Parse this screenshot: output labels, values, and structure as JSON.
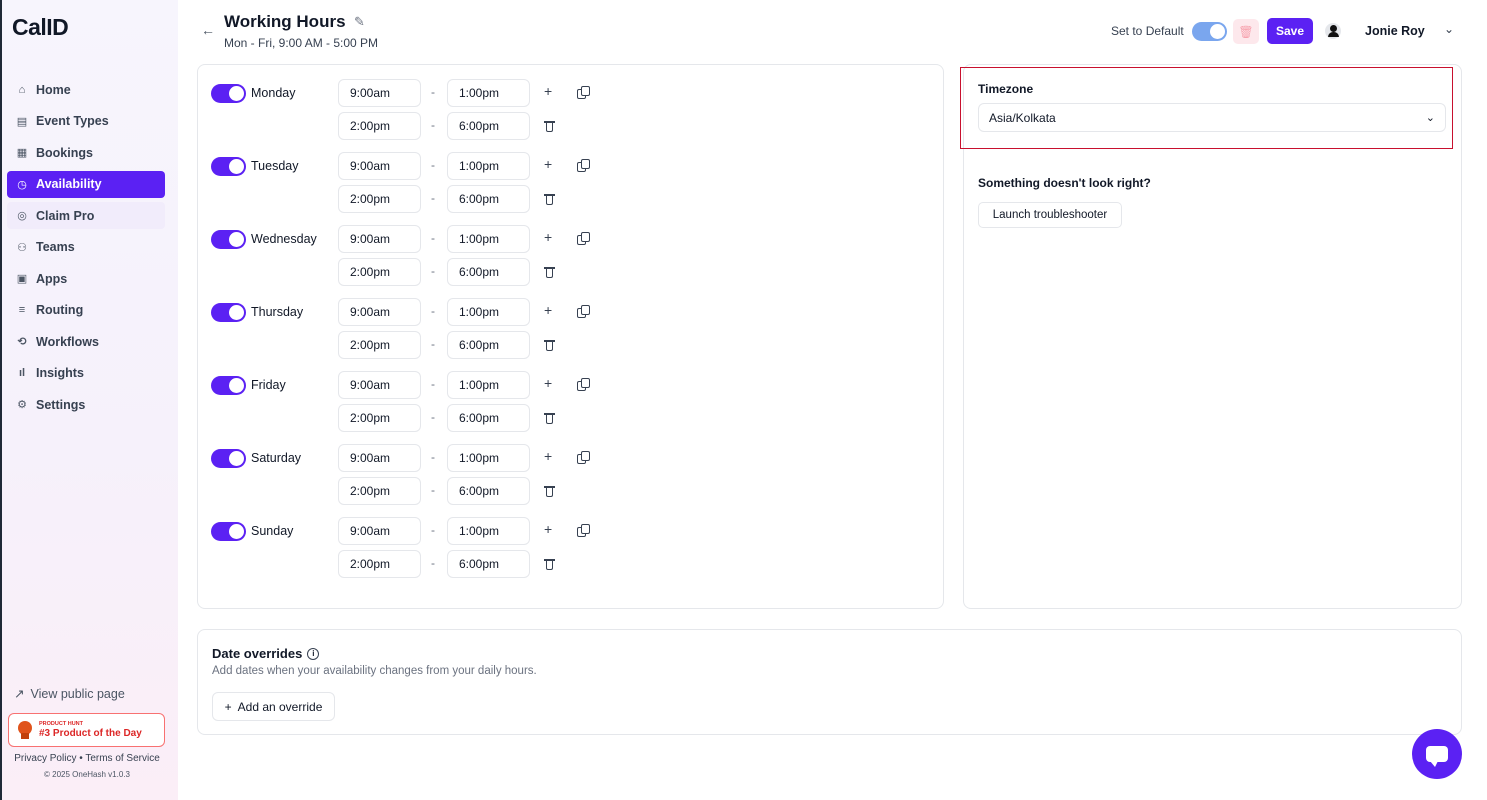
{
  "app": {
    "logo": "CalID"
  },
  "sidebar": {
    "items": [
      {
        "label": "Home",
        "icon": "home-icon",
        "glyph": "⌂"
      },
      {
        "label": "Event Types",
        "icon": "event-types-icon",
        "glyph": "▤"
      },
      {
        "label": "Bookings",
        "icon": "calendar-icon",
        "glyph": "▦"
      },
      {
        "label": "Availability",
        "icon": "clock-icon",
        "glyph": "◷"
      },
      {
        "label": "Claim Pro",
        "icon": "badge-icon",
        "glyph": "◎"
      },
      {
        "label": "Teams",
        "icon": "users-icon",
        "glyph": "⚇"
      },
      {
        "label": "Apps",
        "icon": "grid-icon",
        "glyph": "▣"
      },
      {
        "label": "Routing",
        "icon": "routing-icon",
        "glyph": "≡"
      },
      {
        "label": "Workflows",
        "icon": "workflow-icon",
        "glyph": "⟲"
      },
      {
        "label": "Insights",
        "icon": "bar-chart-icon",
        "glyph": "ıl"
      },
      {
        "label": "Settings",
        "icon": "gear-icon",
        "glyph": "⚙"
      }
    ],
    "active": "Availability",
    "view_public_page": "View public page",
    "badge_small": "PRODUCT HUNT",
    "badge_big": "#3 Product of the Day",
    "legal": "Privacy Policy • Terms of Service",
    "copyright": "© 2025 OneHash v1.0.3"
  },
  "header": {
    "title": "Working Hours",
    "subtitle": "Mon - Fri, 9:00 AM - 5:00 PM",
    "set_default_label": "Set to Default",
    "save_label": "Save",
    "user_name": "Jonie Roy"
  },
  "schedule": {
    "days": [
      {
        "name": "Monday",
        "enabled": true,
        "slots": [
          [
            "9:00am",
            "1:00pm"
          ],
          [
            "2:00pm",
            "6:00pm"
          ]
        ]
      },
      {
        "name": "Tuesday",
        "enabled": true,
        "slots": [
          [
            "9:00am",
            "1:00pm"
          ],
          [
            "2:00pm",
            "6:00pm"
          ]
        ]
      },
      {
        "name": "Wednesday",
        "enabled": true,
        "slots": [
          [
            "9:00am",
            "1:00pm"
          ],
          [
            "2:00pm",
            "6:00pm"
          ]
        ]
      },
      {
        "name": "Thursday",
        "enabled": true,
        "slots": [
          [
            "9:00am",
            "1:00pm"
          ],
          [
            "2:00pm",
            "6:00pm"
          ]
        ]
      },
      {
        "name": "Friday",
        "enabled": true,
        "slots": [
          [
            "9:00am",
            "1:00pm"
          ],
          [
            "2:00pm",
            "6:00pm"
          ]
        ]
      },
      {
        "name": "Saturday",
        "enabled": true,
        "slots": [
          [
            "9:00am",
            "1:00pm"
          ],
          [
            "2:00pm",
            "6:00pm"
          ]
        ]
      },
      {
        "name": "Sunday",
        "enabled": true,
        "slots": [
          [
            "9:00am",
            "1:00pm"
          ],
          [
            "2:00pm",
            "6:00pm"
          ]
        ]
      }
    ]
  },
  "timezone": {
    "label": "Timezone",
    "value": "Asia/Kolkata",
    "help_text": "Something doesn't look right?",
    "troubleshooter_label": "Launch troubleshooter"
  },
  "overrides": {
    "title": "Date overrides",
    "subtitle": "Add dates when your availability changes from your daily hours.",
    "add_label": "Add an override"
  },
  "colors": {
    "accent": "#5b21f3",
    "highlight_border": "#c8102e",
    "badge_red": "#dc2626"
  }
}
